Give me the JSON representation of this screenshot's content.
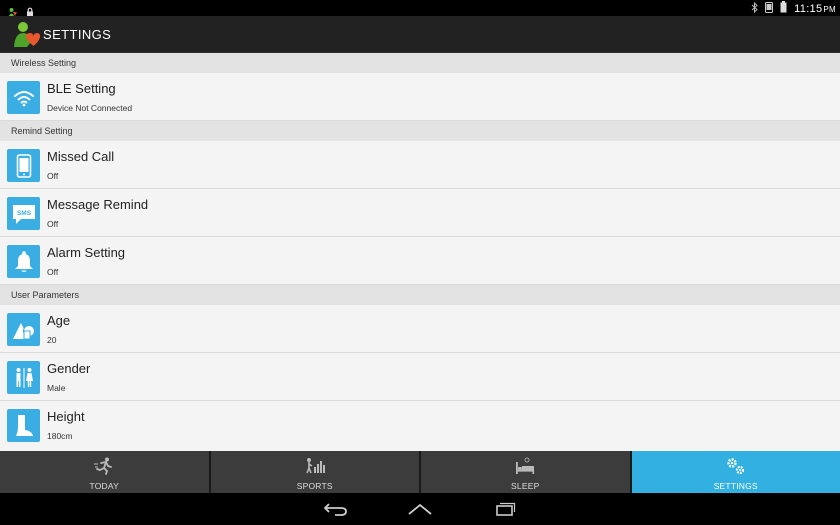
{
  "status_bar": {
    "time": "11:15",
    "ampm": "PM",
    "icons": [
      "app-notification-icon",
      "lock-icon",
      "bluetooth-icon",
      "phone-signal-icon",
      "battery-icon"
    ]
  },
  "action_bar": {
    "title": "SETTINGS",
    "logo_icon": "app-logo-icon"
  },
  "sections": [
    {
      "header": "Wireless Setting",
      "items": [
        {
          "title": "BLE Setting",
          "subtitle": "Device Not Connected",
          "icon": "wifi-icon"
        }
      ]
    },
    {
      "header": "Remind Setting",
      "items": [
        {
          "title": "Missed Call",
          "subtitle": "Off",
          "icon": "phone-icon"
        },
        {
          "title": "Message Remind",
          "subtitle": "Off",
          "icon": "sms-icon"
        },
        {
          "title": "Alarm Setting",
          "subtitle": "Off",
          "icon": "bell-icon"
        }
      ]
    },
    {
      "header": "User Parameters",
      "items": [
        {
          "title": "Age",
          "subtitle": "20",
          "icon": "age-shapes-icon"
        },
        {
          "title": "Gender",
          "subtitle": "Male",
          "icon": "gender-icon"
        },
        {
          "title": "Height",
          "subtitle": "180cm",
          "icon": "boot-icon"
        }
      ]
    }
  ],
  "sms_icon_text": "SMS",
  "tabs": [
    {
      "label": "TODAY",
      "icon": "running-icon",
      "active": false
    },
    {
      "label": "SPORTS",
      "icon": "sports-stats-icon",
      "active": false
    },
    {
      "label": "SLEEP",
      "icon": "bed-icon",
      "active": false
    },
    {
      "label": "SETTINGS",
      "icon": "gears-icon",
      "active": true
    }
  ],
  "colors": {
    "accent": "#32b0e2",
    "icon_bg": "#3aaee3",
    "action_bar": "#222222",
    "content_bg": "#f4f4f4",
    "section_bg": "#e3e3e3",
    "tab_bg": "#3c3c3c"
  }
}
